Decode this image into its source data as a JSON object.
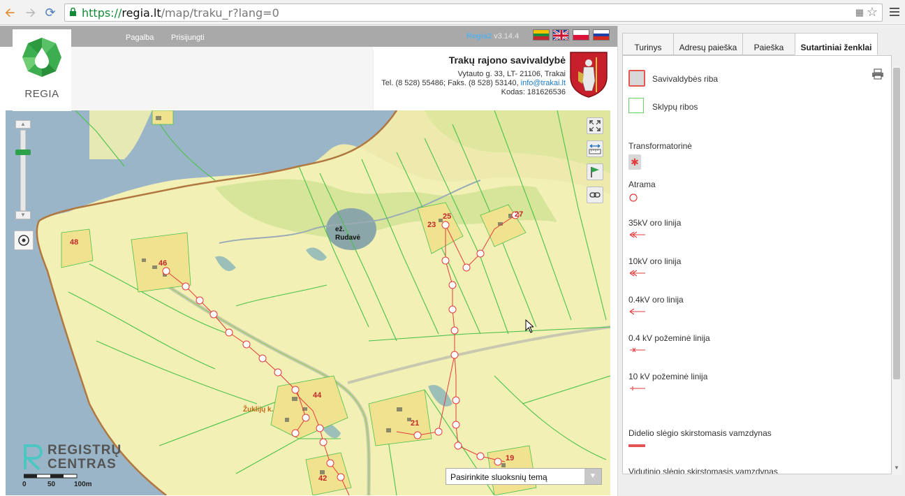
{
  "browser": {
    "url_scheme": "https://",
    "url_host": "regia.lt",
    "url_path": "/map/traku_r?lang=0"
  },
  "header": {
    "logo_text": "REGIA",
    "nav": {
      "help": "Pagalba",
      "login": "Prisijungti"
    },
    "version_name": "Regia2",
    "version_number": " v3.14.4"
  },
  "municipality": {
    "name": "Trakų rajono savivaldybė",
    "address": "Vytauto g. 33, LT- 21106, Trakai",
    "phone_fax": "Tel. (8 528) 55486; Faks. (8 528) 53140,",
    "email": "info@trakai.lt",
    "code": "Kodas: 181626536"
  },
  "map": {
    "labels": {
      "lake": "ež.",
      "lake2": "Rudavė",
      "village": "Žuklijų k."
    },
    "plots": [
      "48",
      "46",
      "23",
      "25",
      "27",
      "44",
      "21",
      "19",
      "42"
    ],
    "layer_select": "Pasirinkite sluoksnių temą",
    "brand_line1": "REGISTRŲ",
    "brand_line2": "CENTRAS",
    "scale": [
      "0",
      "50",
      "100m"
    ]
  },
  "panel": {
    "tabs": [
      "Turinys",
      "Adresų paieška",
      "Paieška",
      "Sutartiniai ženklai"
    ],
    "legend": [
      "Savivaldybės riba",
      "Sklypų ribos",
      "Transformatorinė",
      "Atrama",
      "35kV oro linija",
      "10kV oro linija",
      "0.4kV oro linija",
      "0.4 kV požeminė linija",
      "10 kV požeminė linija",
      "Didelio slėgio skirstomasis vamzdynas",
      "Vidutinio slėgio skirstomasis vamzdynas"
    ]
  },
  "colors": {
    "water": "#9ab5c8",
    "land": "#f3f0b6",
    "forest": "#d6e59a",
    "boundary": "#b07840",
    "parcel": "#49c14a",
    "electric": "#e23b3b",
    "brand_green": "#2ea24b"
  }
}
